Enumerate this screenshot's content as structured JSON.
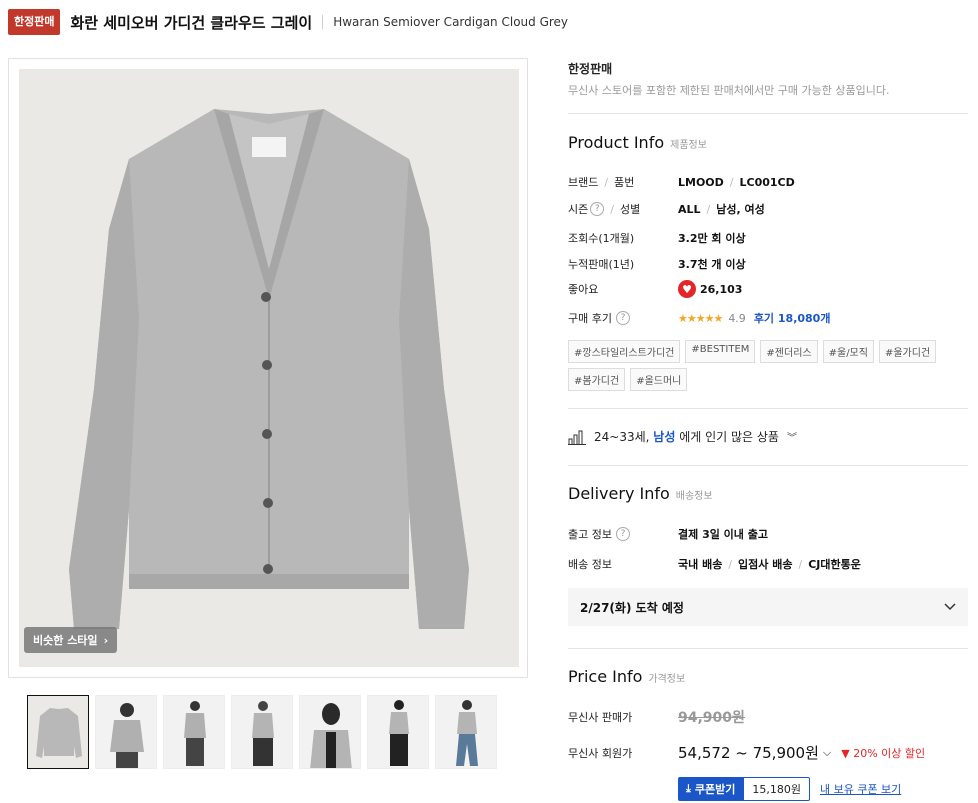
{
  "header": {
    "badge": "한정판매",
    "title_ko": "화란 세미오버 가디건 클라우드 그레이",
    "title_en": "Hwaran Semiover Cardigan Cloud Grey"
  },
  "gallery": {
    "similar_style_label": "비슷한 스타일",
    "thumb_count": 7
  },
  "limited": {
    "title": "한정판매",
    "description": "무신사 스토어를 포함한 제한된 판매처에서만 구매 가능한 상품입니다."
  },
  "product_info": {
    "title": "Product Info",
    "subtitle": "제품정보",
    "brand_label_a": "브랜드",
    "brand_label_b": "품번",
    "brand": "LMOOD",
    "code": "LC001CD",
    "season_label_a": "시즌",
    "season_label_b": "성별",
    "season": "ALL",
    "gender": "남성, 여성",
    "views_label": "조회수(1개월)",
    "views": "3.2만 회 이상",
    "sales_label": "누적판매(1년)",
    "sales": "3.7천 개 이상",
    "likes_label": "좋아요",
    "likes": "26,103",
    "review_label": "구매 후기",
    "stars": "★★★★★",
    "rating": "4.9",
    "reviews": "후기 18,080개",
    "tags": [
      "#깡스타일리스트가디건",
      "#BESTITEM",
      "#젠더리스",
      "#울/모직",
      "#울가디건",
      "#봄가디건",
      "#올드머니"
    ]
  },
  "popular": {
    "age": "24~33세,",
    "gender": "남성",
    "suffix": "에게 인기 많은 상품"
  },
  "delivery": {
    "title": "Delivery Info",
    "subtitle": "배송정보",
    "ship_label": "출고 정보",
    "ship_value": "결제 3일 이내 출고",
    "method_label": "배송 정보",
    "method_a": "국내 배송",
    "method_b": "입점사 배송",
    "method_c": "CJ대한통운",
    "arrival": "2/27(화) 도착 예정"
  },
  "price": {
    "title": "Price Info",
    "subtitle": "가격정보",
    "sale_label": "무신사 판매가",
    "sale_price": "94,900원",
    "member_label": "무신사 회원가",
    "member_price": "54,572 ~ 75,900원",
    "discount": "20% 이상 할인",
    "coupon_button": "쿠폰받기",
    "coupon_amount": "15,180원",
    "coupon_link": "내 보유 쿠폰 보기"
  },
  "colors": {
    "badge": "#c0392b",
    "accent_blue": "#1a56c8",
    "accent_red": "#e3262a",
    "cardigan": "#b4b4b4"
  }
}
